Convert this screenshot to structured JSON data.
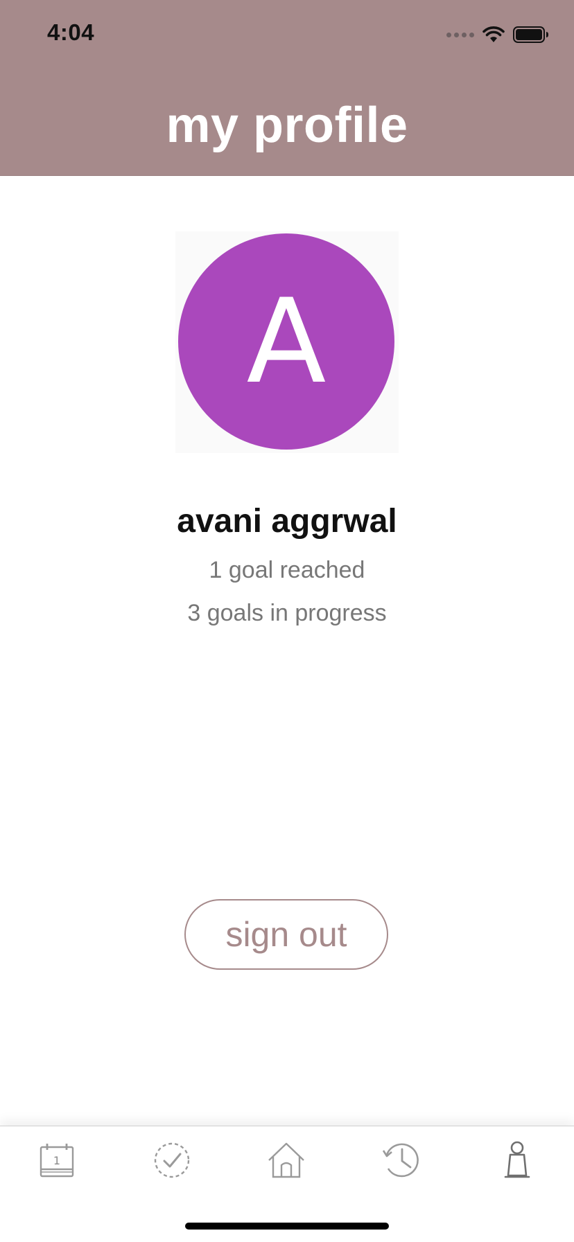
{
  "status_bar": {
    "time": "4:04"
  },
  "header": {
    "title": "my profile",
    "background_color": "#a68a8b"
  },
  "profile": {
    "avatar_initial": "A",
    "avatar_color": "#aa48bc",
    "name": "avani aggrwal",
    "goals_reached": "1 goal reached",
    "goals_in_progress": "3 goals in progress"
  },
  "actions": {
    "sign_out_label": "sign out"
  },
  "tab_bar": {
    "items": [
      {
        "name": "calendar",
        "icon": "calendar-icon",
        "badge": "1"
      },
      {
        "name": "goals",
        "icon": "check-circle-icon"
      },
      {
        "name": "home",
        "icon": "home-icon"
      },
      {
        "name": "history",
        "icon": "history-icon"
      },
      {
        "name": "profile",
        "icon": "person-icon"
      }
    ]
  }
}
